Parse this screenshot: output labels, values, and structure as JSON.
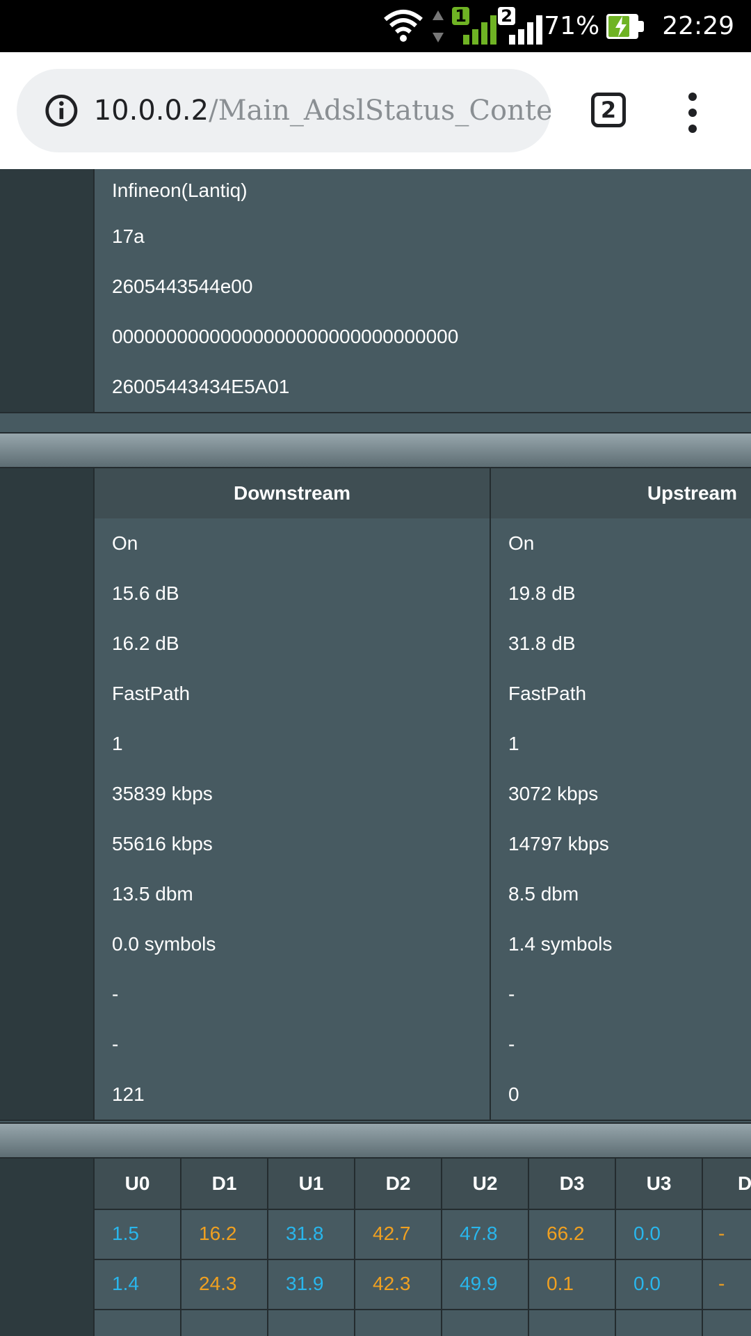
{
  "status_bar": {
    "battery": "71%",
    "time": "22:29",
    "sim1": "1",
    "sim2": "2"
  },
  "browser": {
    "url_host": "10.0.0.2",
    "url_path": "/Main_AdslStatus_Content",
    "tab_count": "2"
  },
  "info_rows": [
    "Infineon(Lantiq)",
    "17a",
    "2605443544e00",
    "00000000000000000000000000000000",
    "26005443434E5A01"
  ],
  "stats": {
    "headers": [
      "Downstream",
      "Upstream"
    ],
    "rows": [
      [
        "On",
        "On"
      ],
      [
        "15.6 dB",
        "19.8 dB"
      ],
      [
        "16.2 dB",
        "31.8 dB"
      ],
      [
        "FastPath",
        "FastPath"
      ],
      [
        "1",
        "1"
      ],
      [
        "35839 kbps",
        "3072 kbps"
      ],
      [
        "55616 kbps",
        "14797 kbps"
      ],
      [
        "13.5 dbm",
        "8.5 dbm"
      ],
      [
        "0.0 symbols",
        "1.4 symbols"
      ],
      [
        "-",
        "-"
      ],
      [
        "-",
        "-"
      ],
      [
        "121",
        "0"
      ]
    ]
  },
  "bands": {
    "headers": [
      "U0",
      "D1",
      "U1",
      "D2",
      "U2",
      "D3",
      "U3",
      "D"
    ],
    "rows": [
      [
        "1.5",
        "16.2",
        "31.8",
        "42.7",
        "47.8",
        "66.2",
        "0.0",
        "-"
      ],
      [
        "1.4",
        "24.3",
        "31.9",
        "42.3",
        "49.9",
        "0.1",
        "0.0",
        "-"
      ]
    ]
  },
  "colors": {
    "upstream": "#29b6ec",
    "downstream": "#f0a020",
    "cell_bg": "#475a61"
  }
}
